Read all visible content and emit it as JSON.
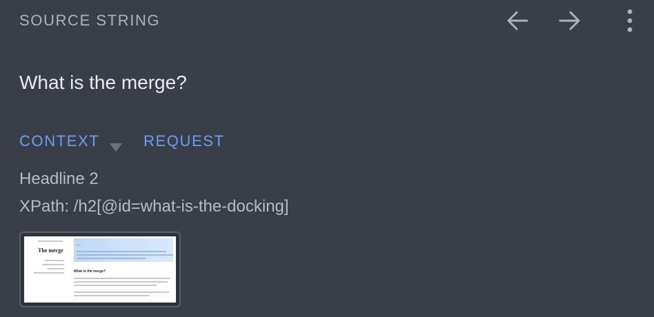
{
  "header": {
    "section_label": "SOURCE STRING",
    "prev_icon": "arrow-left-icon",
    "next_icon": "arrow-right-icon",
    "more_icon": "more-vertical-icon"
  },
  "source": {
    "text": "What is the merge?"
  },
  "tabs": [
    {
      "label": "CONTEXT",
      "has_dropdown": true
    },
    {
      "label": "REQUEST",
      "has_dropdown": false
    }
  ],
  "context": {
    "element_type": "Headline 2",
    "xpath": "XPath: /h2[@id=what-is-the-docking]"
  },
  "screenshot_thumbnail": {
    "page_title": "The merge",
    "banner_title": "...",
    "heading": "What is the merge?"
  },
  "colors": {
    "background": "#393e48",
    "accent": "#6b9ef2",
    "muted_text": "#aeb3ba",
    "primary_text": "#e9ebee"
  }
}
